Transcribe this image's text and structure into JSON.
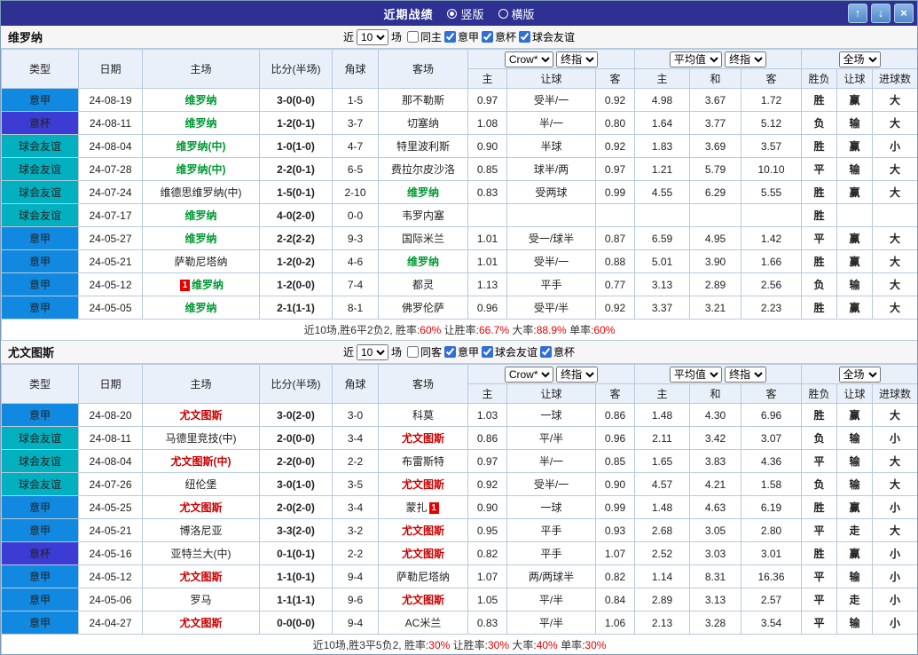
{
  "titlebar": {
    "title": "近期战绩",
    "radios": [
      {
        "label": "竖版",
        "selected": true
      },
      {
        "label": "横版",
        "selected": false
      }
    ],
    "buttons": {
      "up": "↑",
      "down": "↓",
      "close": "×"
    }
  },
  "filter_text": {
    "prefix": "近",
    "suffix": "场"
  },
  "table_head": {
    "left_cols": [
      "类型",
      "日期",
      "主场",
      "比分(半场)",
      "角球",
      "客场"
    ],
    "group1_selects": [
      "Crow*",
      "终指"
    ],
    "group2_selects": [
      "平均值",
      "终指"
    ],
    "group3_selects": [
      "全场"
    ],
    "sub_cols": [
      "主",
      "让球",
      "客",
      "主",
      "和",
      "客",
      "胜负",
      "让球",
      "进球数"
    ]
  },
  "league_colors": {
    "意甲": "#1289e0",
    "意杯": "#3c3cd4",
    "球会友谊": "#02b0bf"
  },
  "result_colors": {
    "胜": "r",
    "负": "b",
    "平": "g",
    "赢": "r",
    "输": "b",
    "走": "g",
    "大": "r",
    "小": "b"
  },
  "sections": [
    {
      "team": "维罗纳",
      "rounds": "10",
      "highlight": "#009933",
      "filters": [
        {
          "label": "同主",
          "checked": false
        },
        {
          "label": "意甲",
          "checked": true
        },
        {
          "label": "意杯",
          "checked": true
        },
        {
          "label": "球会友谊",
          "checked": true
        }
      ],
      "rows": [
        {
          "league": "意甲",
          "date": "24-08-19",
          "home": "维罗纳",
          "home_hl": true,
          "score": "3-0(0-0)",
          "corners": "1-5",
          "away": "那不勒斯",
          "o1": "0.97",
          "hcap": "受半/一",
          "o2": "0.92",
          "a1": "4.98",
          "a2": "3.67",
          "a3": "1.72",
          "r1": "胜",
          "r2": "赢",
          "r3": "大"
        },
        {
          "league": "意杯",
          "date": "24-08-11",
          "home": "维罗纳",
          "home_hl": true,
          "score": "1-2(0-1)",
          "corners": "3-7",
          "away": "切塞纳",
          "o1": "1.08",
          "hcap": "半/一",
          "o2": "0.80",
          "a1": "1.64",
          "a2": "3.77",
          "a3": "5.12",
          "r1": "负",
          "r2": "输",
          "r3": "大"
        },
        {
          "league": "球会友谊",
          "date": "24-08-04",
          "home": "维罗纳(中)",
          "home_hl": true,
          "score": "1-0(1-0)",
          "corners": "4-7",
          "away": "特里波利斯",
          "o1": "0.90",
          "hcap": "半球",
          "o2": "0.92",
          "a1": "1.83",
          "a2": "3.69",
          "a3": "3.57",
          "r1": "胜",
          "r2": "赢",
          "r3": "小"
        },
        {
          "league": "球会友谊",
          "date": "24-07-28",
          "home": "维罗纳(中)",
          "home_hl": true,
          "score": "2-2(0-1)",
          "corners": "6-5",
          "away": "费拉尔皮沙洛",
          "o1": "0.85",
          "hcap": "球半/两",
          "o2": "0.97",
          "a1": "1.21",
          "a2": "5.79",
          "a3": "10.10",
          "r1": "平",
          "r2": "输",
          "r3": "大"
        },
        {
          "league": "球会友谊",
          "date": "24-07-24",
          "home": "维德思维罗纳(中)",
          "score": "1-5(0-1)",
          "corners": "2-10",
          "away": "维罗纳",
          "away_hl": true,
          "o1": "0.83",
          "hcap": "受两球",
          "o2": "0.99",
          "a1": "4.55",
          "a2": "6.29",
          "a3": "5.55",
          "r1": "胜",
          "r2": "赢",
          "r3": "大"
        },
        {
          "league": "球会友谊",
          "date": "24-07-17",
          "home": "维罗纳",
          "home_hl": true,
          "score": "4-0(2-0)",
          "corners": "0-0",
          "away": "韦罗内塞",
          "o1": "",
          "hcap": "",
          "o2": "",
          "a1": "",
          "a2": "",
          "a3": "",
          "r1": "胜",
          "r2": "",
          "r3": ""
        },
        {
          "league": "意甲",
          "date": "24-05-27",
          "home": "维罗纳",
          "home_hl": true,
          "score": "2-2(2-2)",
          "corners": "9-3",
          "away": "国际米兰",
          "o1": "1.01",
          "hcap": "受一/球半",
          "o2": "0.87",
          "a1": "6.59",
          "a2": "4.95",
          "a3": "1.42",
          "r1": "平",
          "r2": "赢",
          "r3": "大"
        },
        {
          "league": "意甲",
          "date": "24-05-21",
          "home": "萨勒尼塔纳",
          "score": "1-2(0-2)",
          "corners": "4-6",
          "away": "维罗纳",
          "away_hl": true,
          "o1": "1.01",
          "hcap": "受半/一",
          "o2": "0.88",
          "a1": "5.01",
          "a2": "3.90",
          "a3": "1.66",
          "r1": "胜",
          "r2": "赢",
          "r3": "大"
        },
        {
          "league": "意甲",
          "date": "24-05-12",
          "home": "维罗纳",
          "home_hl": true,
          "home_card": "1",
          "home_card_side": "left",
          "score": "1-2(0-0)",
          "corners": "7-4",
          "away": "都灵",
          "o1": "1.13",
          "hcap": "平手",
          "o2": "0.77",
          "a1": "3.13",
          "a2": "2.89",
          "a3": "2.56",
          "r1": "负",
          "r2": "输",
          "r3": "大"
        },
        {
          "league": "意甲",
          "date": "24-05-05",
          "home": "维罗纳",
          "home_hl": true,
          "score": "2-1(1-1)",
          "corners": "8-1",
          "away": "佛罗伦萨",
          "o1": "0.96",
          "hcap": "受平/半",
          "o2": "0.92",
          "a1": "3.37",
          "a2": "3.21",
          "a3": "2.23",
          "r1": "胜",
          "r2": "赢",
          "r3": "大"
        }
      ],
      "summary": [
        {
          "t": "近10场,胜6平2负2, 胜率:"
        },
        {
          "t": "60%",
          "red": true
        },
        {
          "t": " 让胜率:"
        },
        {
          "t": "66.7%",
          "red": true
        },
        {
          "t": " 大率:"
        },
        {
          "t": "88.9%",
          "red": true
        },
        {
          "t": " 单率:"
        },
        {
          "t": "60%",
          "red": true
        }
      ]
    },
    {
      "team": "尤文图斯",
      "rounds": "10",
      "highlight": "#cc0000",
      "filters": [
        {
          "label": "同客",
          "checked": false
        },
        {
          "label": "意甲",
          "checked": true
        },
        {
          "label": "球会友谊",
          "checked": true
        },
        {
          "label": "意杯",
          "checked": true
        }
      ],
      "rows": [
        {
          "league": "意甲",
          "date": "24-08-20",
          "home": "尤文图斯",
          "home_hl": true,
          "score": "3-0(2-0)",
          "corners": "3-0",
          "away": "科莫",
          "o1": "1.03",
          "hcap": "一球",
          "o2": "0.86",
          "a1": "1.48",
          "a2": "4.30",
          "a3": "6.96",
          "r1": "胜",
          "r2": "赢",
          "r3": "大"
        },
        {
          "league": "球会友谊",
          "date": "24-08-11",
          "home": "马德里竞技(中)",
          "score": "2-0(0-0)",
          "corners": "3-4",
          "away": "尤文图斯",
          "away_hl": true,
          "o1": "0.86",
          "hcap": "平/半",
          "o2": "0.96",
          "a1": "2.11",
          "a2": "3.42",
          "a3": "3.07",
          "r1": "负",
          "r2": "输",
          "r3": "小"
        },
        {
          "league": "球会友谊",
          "date": "24-08-04",
          "home": "尤文图斯(中)",
          "home_hl": true,
          "score": "2-2(0-0)",
          "corners": "2-2",
          "away": "布雷斯特",
          "o1": "0.97",
          "hcap": "半/一",
          "o2": "0.85",
          "a1": "1.65",
          "a2": "3.83",
          "a3": "4.36",
          "r1": "平",
          "r2": "输",
          "r3": "大"
        },
        {
          "league": "球会友谊",
          "date": "24-07-26",
          "home": "纽伦堡",
          "score": "3-0(1-0)",
          "corners": "3-5",
          "away": "尤文图斯",
          "away_hl": true,
          "o1": "0.92",
          "hcap": "受半/一",
          "o2": "0.90",
          "a1": "4.57",
          "a2": "4.21",
          "a3": "1.58",
          "r1": "负",
          "r2": "输",
          "r3": "大"
        },
        {
          "league": "意甲",
          "date": "24-05-25",
          "home": "尤文图斯",
          "home_hl": true,
          "score": "2-0(2-0)",
          "corners": "3-4",
          "away": "蒙扎",
          "away_card": "1",
          "away_card_side": "right",
          "o1": "0.90",
          "hcap": "一球",
          "o2": "0.99",
          "a1": "1.48",
          "a2": "4.63",
          "a3": "6.19",
          "r1": "胜",
          "r2": "赢",
          "r3": "小"
        },
        {
          "league": "意甲",
          "date": "24-05-21",
          "home": "博洛尼亚",
          "score": "3-3(2-0)",
          "corners": "3-2",
          "away": "尤文图斯",
          "away_hl": true,
          "o1": "0.95",
          "hcap": "平手",
          "o2": "0.93",
          "a1": "2.68",
          "a2": "3.05",
          "a3": "2.80",
          "r1": "平",
          "r2": "走",
          "r3": "大"
        },
        {
          "league": "意杯",
          "date": "24-05-16",
          "home": "亚特兰大(中)",
          "score": "0-1(0-1)",
          "corners": "2-2",
          "away": "尤文图斯",
          "away_hl": true,
          "o1": "0.82",
          "hcap": "平手",
          "o2": "1.07",
          "a1": "2.52",
          "a2": "3.03",
          "a3": "3.01",
          "r1": "胜",
          "r2": "赢",
          "r3": "小"
        },
        {
          "league": "意甲",
          "date": "24-05-12",
          "home": "尤文图斯",
          "home_hl": true,
          "score": "1-1(0-1)",
          "corners": "9-4",
          "away": "萨勒尼塔纳",
          "o1": "1.07",
          "hcap": "两/两球半",
          "o2": "0.82",
          "a1": "1.14",
          "a2": "8.31",
          "a3": "16.36",
          "r1": "平",
          "r2": "输",
          "r3": "小"
        },
        {
          "league": "意甲",
          "date": "24-05-06",
          "home": "罗马",
          "score": "1-1(1-1)",
          "corners": "9-6",
          "away": "尤文图斯",
          "away_hl": true,
          "o1": "1.05",
          "hcap": "平/半",
          "o2": "0.84",
          "a1": "2.89",
          "a2": "3.13",
          "a3": "2.57",
          "r1": "平",
          "r2": "走",
          "r3": "小"
        },
        {
          "league": "意甲",
          "date": "24-04-27",
          "home": "尤文图斯",
          "home_hl": true,
          "score": "0-0(0-0)",
          "corners": "9-4",
          "away": "AC米兰",
          "o1": "0.83",
          "hcap": "平/半",
          "o2": "1.06",
          "a1": "2.13",
          "a2": "3.28",
          "a3": "3.54",
          "r1": "平",
          "r2": "输",
          "r3": "小"
        }
      ],
      "summary": [
        {
          "t": "近10场,胜3平5负2, 胜率:"
        },
        {
          "t": "30%",
          "red": true
        },
        {
          "t": " 让胜率:"
        },
        {
          "t": "30%",
          "red": true
        },
        {
          "t": " 大率:"
        },
        {
          "t": "40%",
          "red": true
        },
        {
          "t": " 单率:"
        },
        {
          "t": "30%",
          "red": true
        }
      ]
    }
  ]
}
